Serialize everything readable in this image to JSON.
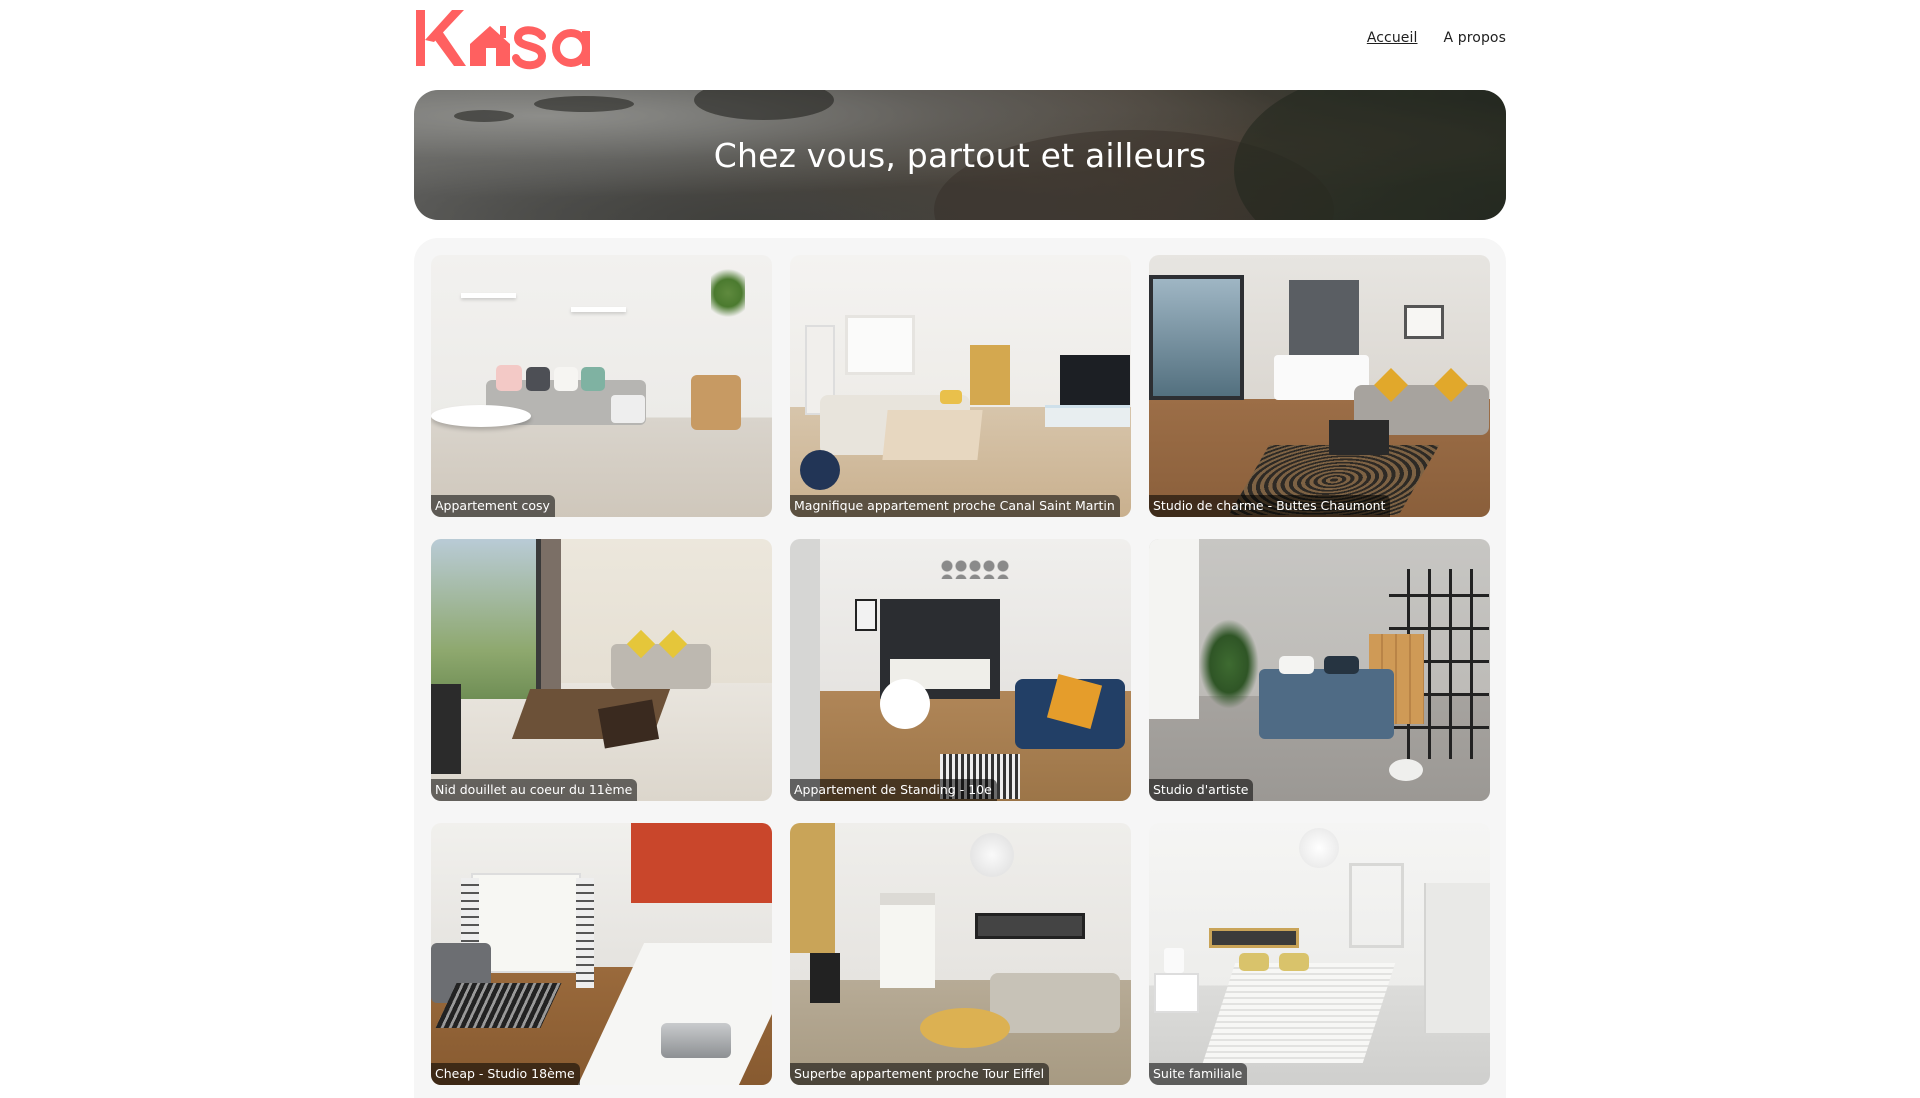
{
  "header": {
    "logo_text": "Kasa",
    "brand_color": "#FF6060",
    "nav": [
      {
        "label": "Accueil",
        "active": true
      },
      {
        "label": "A propos",
        "active": false
      }
    ]
  },
  "banner": {
    "title": "Chez vous, partout et ailleurs"
  },
  "listings": [
    {
      "title": "Appartement cosy"
    },
    {
      "title": "Magnifique appartement proche Canal Saint Martin"
    },
    {
      "title": "Studio de charme - Buttes Chaumont"
    },
    {
      "title": "Nid douillet au coeur du 11ème"
    },
    {
      "title": "Appartement de Standing - 10e"
    },
    {
      "title": "Studio d'artiste"
    },
    {
      "title": "Cheap - Studio 18ème"
    },
    {
      "title": "Superbe appartement proche Tour Eiffel"
    },
    {
      "title": "Suite familiale"
    }
  ]
}
